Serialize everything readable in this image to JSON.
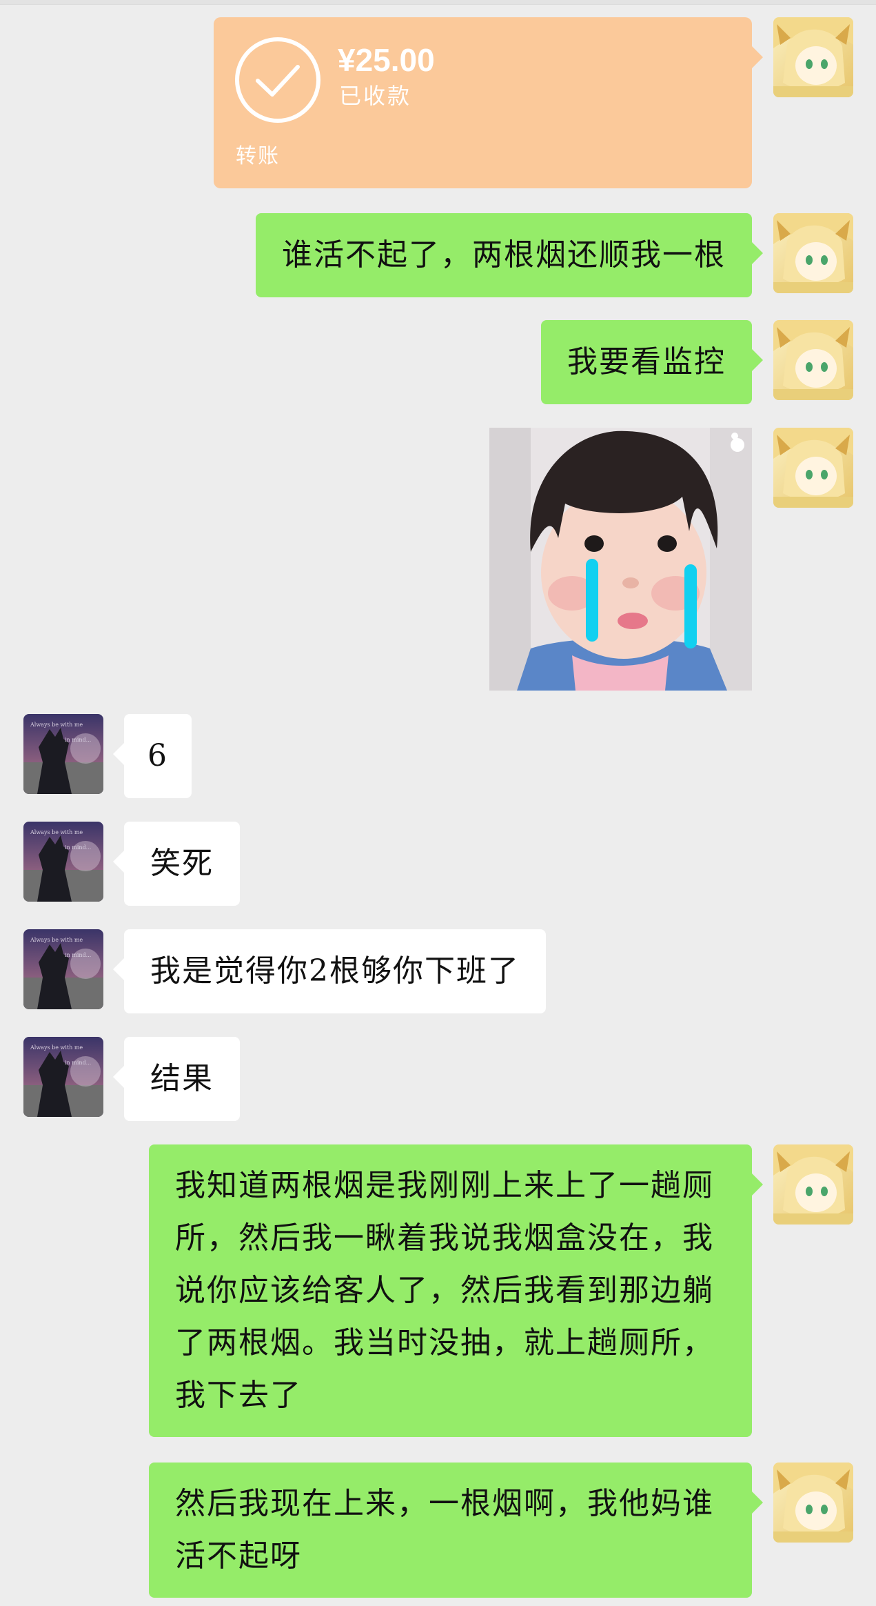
{
  "chat": {
    "transfer": {
      "amount": "¥25.00",
      "status": "已收款",
      "kind": "转账"
    },
    "messages": [
      {
        "side": "right",
        "text": "谁活不起了，两根烟还顺我一根"
      },
      {
        "side": "right",
        "text": "我要看监控"
      },
      {
        "side": "right",
        "type": "sticker",
        "icon": "crying-girl-sticker"
      },
      {
        "side": "left",
        "text": "6"
      },
      {
        "side": "left",
        "text": "笑死"
      },
      {
        "side": "left",
        "text": "我是觉得你2根够你下班了"
      },
      {
        "side": "left",
        "text": "结果"
      },
      {
        "side": "right",
        "lines": [
          "我知道两根烟是我刚刚上来上了一趟厕",
          "所，然后我一瞅着我说我烟盒没在，我",
          "说你应该给客人了，然后我看到那边躺",
          "了两根烟。我当时没抽，就上趟厕所，",
          "我下去了"
        ]
      },
      {
        "side": "right",
        "lines": [
          "然后我现在上来，一根烟啊，我他妈谁",
          "活不起呀"
        ]
      }
    ]
  },
  "colors": {
    "background": "#ededed",
    "outgoing_bubble": "#95ec69",
    "incoming_bubble": "#ffffff",
    "transfer_card": "#fbc99a"
  }
}
